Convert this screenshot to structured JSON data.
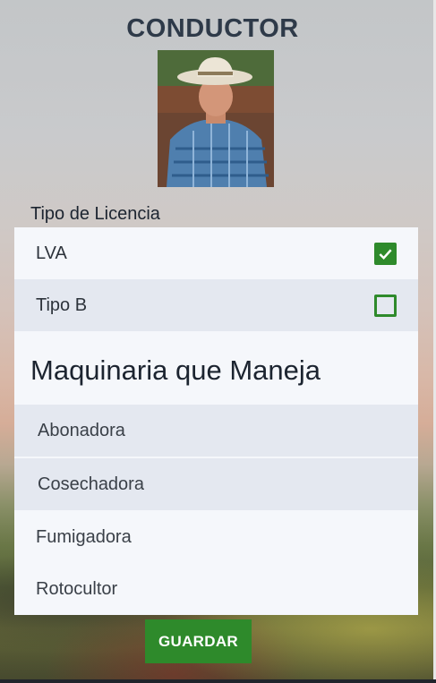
{
  "header": {
    "title": "CONDUCTOR"
  },
  "license": {
    "label": "Tipo de Licencia",
    "options": [
      {
        "label": "LVA",
        "checked": true
      },
      {
        "label": "Tipo B",
        "checked": false
      }
    ]
  },
  "machinery": {
    "heading": "Maquinaria que Maneja",
    "items": [
      {
        "label": "Abonadora",
        "selected": true
      },
      {
        "label": "Cosechadora",
        "selected": true
      },
      {
        "label": "Fumigadora",
        "selected": false
      },
      {
        "label": "Rotocultor",
        "selected": false
      }
    ]
  },
  "actions": {
    "save_label": "GUARDAR"
  },
  "colors": {
    "accent": "#2e8a2b",
    "title": "#2e3a49",
    "selected_row": "#e4e8f0",
    "card": "#f5f7fb"
  }
}
